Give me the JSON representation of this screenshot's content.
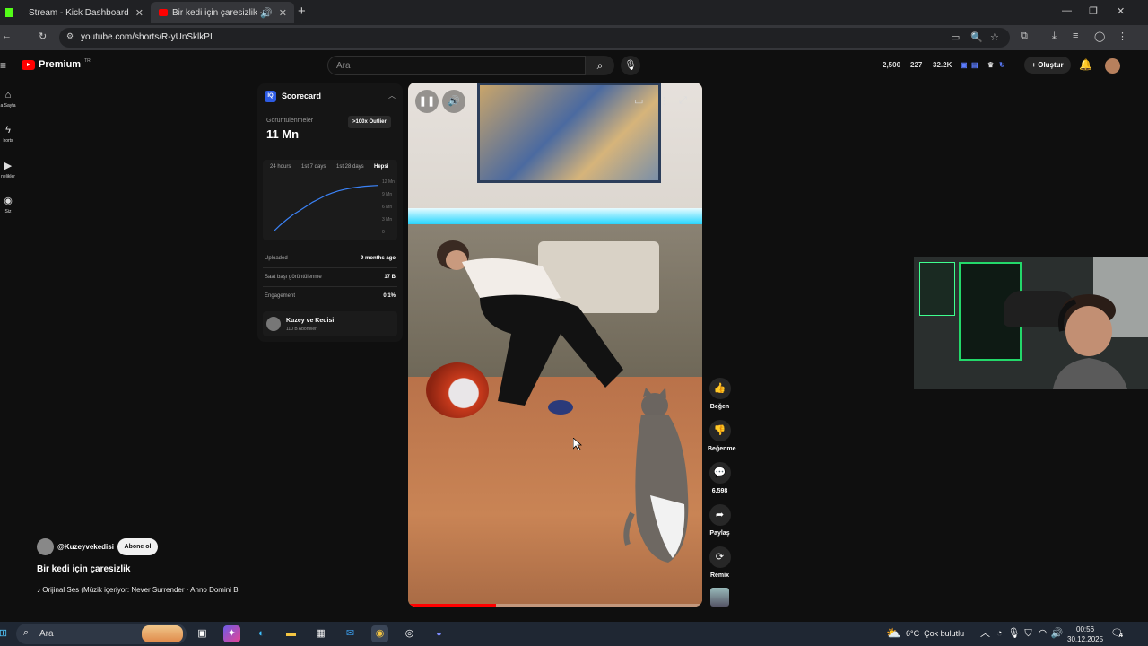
{
  "browser": {
    "tabs": [
      {
        "title": "Stream - Kick Dashboard",
        "active": false,
        "favicon_color": "#53fc18"
      },
      {
        "title": "Bir kedi için çaresizlik - YouTube",
        "active": true,
        "favicon_color": "#ff0000"
      }
    ],
    "url": "youtube.com/shorts/R-yUnSklkPI"
  },
  "youtube": {
    "logo_text": "Premium",
    "logo_sup": "TR",
    "search_placeholder": "Ara",
    "stats": [
      "2,500",
      "227",
      "32.2K"
    ],
    "create_label": "Oluştur"
  },
  "sidebar": {
    "items": [
      {
        "label": "a Sayfa",
        "icon": "home-icon"
      },
      {
        "label": "horts",
        "icon": "shorts-icon"
      },
      {
        "label": "nelikler",
        "icon": "subscriptions-icon"
      },
      {
        "label": "Siz",
        "icon": "you-icon"
      }
    ]
  },
  "scorecard": {
    "title": "Scorecard",
    "logo": "IQ",
    "views_label": "Görüntülenmeler",
    "views_value": "11 Mn",
    "outlier_badge": ">100x Outlier",
    "ranges": [
      "24 hours",
      "1st 7 days",
      "1st 28 days",
      "Hepsi"
    ],
    "active_range": "Hepsi",
    "y_ticks": [
      "12 Mn",
      "9 Mn",
      "6 Mn",
      "3 Mn",
      "0"
    ],
    "rows": [
      {
        "label": "Uploaded",
        "value": "9 months ago"
      },
      {
        "label": "Saat başı görüntülenme",
        "value": "17 B"
      },
      {
        "label": "Engagement",
        "value": "0.1%"
      }
    ],
    "channel": {
      "name": "Kuzey ve Kedisi",
      "subs": "110 B Aboneler"
    }
  },
  "chart_data": {
    "type": "line",
    "series": [
      {
        "values": [
          0,
          1.5,
          2.8,
          4.0,
          5.0,
          6.0,
          7.0,
          7.8,
          8.6,
          9.2,
          9.7,
          10.1,
          10.4,
          10.6,
          10.8,
          10.9,
          11.0
        ]
      }
    ],
    "ylim": [
      0,
      12
    ],
    "y_tick_labels": [
      "12 Mn",
      "9 Mn",
      "6 Mn",
      "3 Mn",
      "0"
    ],
    "line_color": "#3b82f6"
  },
  "video": {
    "progress_fraction": 0.3
  },
  "actions": [
    {
      "label": "Beğen",
      "icon": "thumbs-up-icon"
    },
    {
      "label": "Beğenme",
      "icon": "thumbs-down-icon"
    },
    {
      "label": "6.598",
      "icon": "comment-icon"
    },
    {
      "label": "Paylaş",
      "icon": "share-icon"
    },
    {
      "label": "Remix",
      "icon": "remix-icon"
    }
  ],
  "meta": {
    "channel": "@Kuzeyvekedisi",
    "subscribe": "Abone ol",
    "title": "Bir kedi için çaresizlik",
    "music": "Orijinal Ses (Müzik içeriyor: Never Surrender · Anno Domini B"
  },
  "taskbar": {
    "search": "Ara",
    "weather_temp": "6°C",
    "weather_text": "Çok bulutlu",
    "time": "00:56",
    "date": "30.12.2025",
    "notifications": "4"
  }
}
